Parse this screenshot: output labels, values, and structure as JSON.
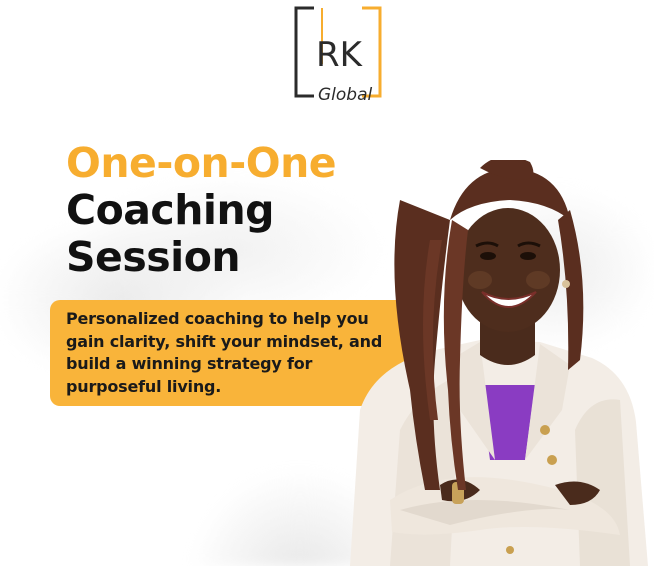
{
  "logo": {
    "letters": "RK",
    "script": "Global",
    "accent_color": "#f7ad2f",
    "frame_color": "#2b2b2b"
  },
  "headline": {
    "line1": "One-on-One",
    "line2": "Coaching",
    "line3": "Session"
  },
  "description": {
    "line1": "Personalized coaching to help you",
    "line2": "gain clarity, shift your mindset, and",
    "line3": "build a winning strategy for",
    "line4": "purposeful living."
  },
  "colors": {
    "accent": "#f7ad2f",
    "card": "#f9b43a",
    "text_dark": "#111111",
    "blazer": "#f3ede6",
    "top": "#8a3cc2"
  }
}
